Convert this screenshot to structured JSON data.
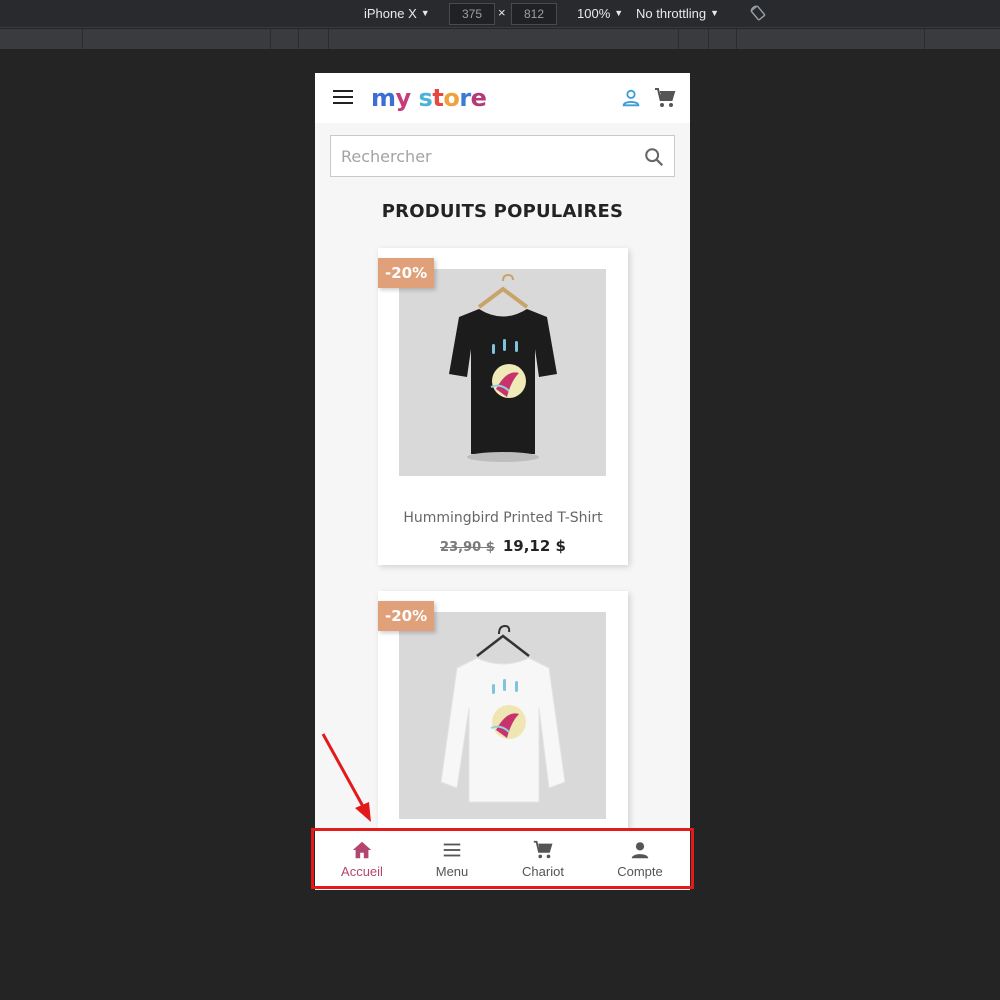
{
  "devtools": {
    "device": "iPhone X",
    "width": "375",
    "height": "812",
    "times": "×",
    "zoom": "100%",
    "throttling": "No throttling",
    "caret": "▼"
  },
  "store": {
    "logo_parts": [
      "m",
      "y",
      " ",
      "s",
      "t",
      "o",
      "r",
      "e"
    ],
    "search_placeholder": "Rechercher",
    "section_title": "PRODUITS POPULAIRES"
  },
  "products": [
    {
      "discount": "-20%",
      "name": "Hummingbird Printed T-Shirt",
      "old_price": "23,90 $",
      "price": "19,12 $",
      "image": "black-tshirt-hummingbird"
    },
    {
      "discount": "-20%",
      "image": "white-longsleeve-hummingbird"
    }
  ],
  "bottom_nav": [
    {
      "label": "Accueil",
      "icon": "home-icon",
      "active": true
    },
    {
      "label": "Menu",
      "icon": "menu-icon",
      "active": false
    },
    {
      "label": "Chariot",
      "icon": "cart-icon",
      "active": false
    },
    {
      "label": "Compte",
      "icon": "account-icon",
      "active": false
    }
  ],
  "colors": {
    "active_nav": "#b3466f",
    "badge": "#e0a17a",
    "highlight": "#e31a1a"
  }
}
